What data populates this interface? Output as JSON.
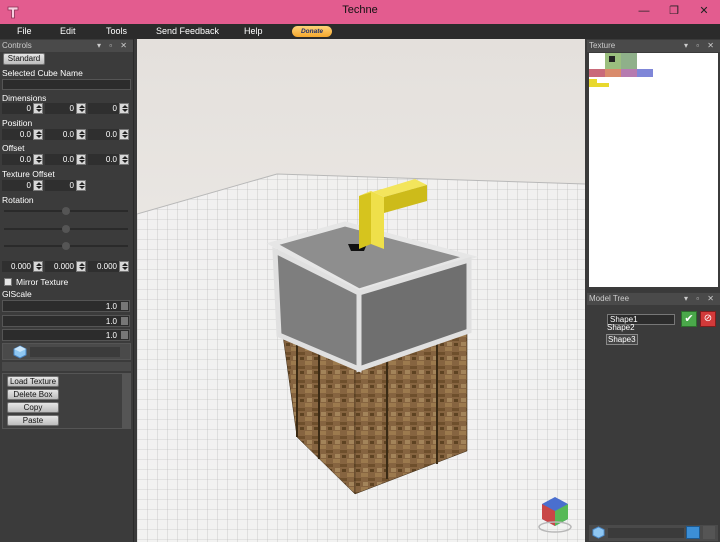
{
  "window": {
    "title": "Techne",
    "minimize": "—",
    "restore": "❐",
    "close": "✕"
  },
  "menu": {
    "file": "File",
    "edit": "Edit",
    "tools": "Tools",
    "feedback": "Send Feedback",
    "help": "Help",
    "donate": "Donate"
  },
  "controls": {
    "header": "Controls",
    "standard_button": "Standard",
    "selected_cube_name_label": "Selected Cube Name",
    "selected_cube_name_value": "",
    "dimensions_label": "Dimensions",
    "dimensions": [
      "0",
      "0",
      "0"
    ],
    "position_label": "Position",
    "position": [
      "0.0",
      "0.0",
      "0.0"
    ],
    "offset_label": "Offset",
    "offset": [
      "0.0",
      "0.0",
      "0.0"
    ],
    "texture_offset_label": "Texture Offset",
    "texture_offset": [
      "0",
      "0"
    ],
    "rotation_label": "Rotation",
    "rotation": [
      "0.000",
      "0.000",
      "0.000"
    ],
    "mirror_texture_label": "Mirror Texture",
    "mirror_texture_checked": false,
    "glscale_label": "GlScale",
    "glscale": [
      "1.0",
      "1.0",
      "1.0"
    ],
    "load_texture": "Load Texture",
    "delete_box": "Delete Box",
    "copy": "Copy",
    "paste": "Paste"
  },
  "texture_panel": {
    "header": "Texture"
  },
  "model_tree": {
    "header": "Model Tree",
    "edit_value": "Shape1",
    "items": [
      "Shape2",
      "Shape3"
    ]
  },
  "colors": {
    "titlebar": "#e35c8f",
    "panel_bg": "#3b3b3b",
    "menu_bg": "#2b2b2b",
    "yellow_shape": "#e8d82e",
    "grey_shape": "#8c8c8c",
    "wood": "#7a5a35"
  }
}
